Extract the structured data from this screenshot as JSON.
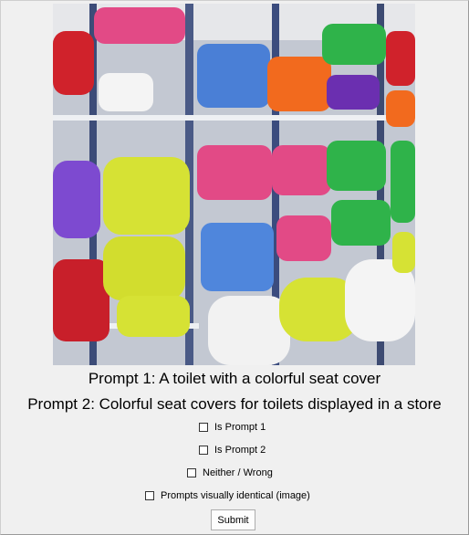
{
  "image": {
    "alt_icon": "photo-store-toilet-seat-covers"
  },
  "prompts": {
    "prompt1": "Prompt 1: A toilet with a colorful seat cover",
    "prompt2": "Prompt 2: Colorful seat covers for toilets displayed in a store"
  },
  "options": [
    {
      "label": "Is Prompt 1",
      "checked": false
    },
    {
      "label": "Is Prompt 2",
      "checked": false
    },
    {
      "label": "Neither / Wrong",
      "checked": false
    },
    {
      "label": "Prompts visually identical (image)",
      "checked": false
    }
  ],
  "submit_label": "Submit",
  "colors": {
    "red": "#d0222b",
    "magenta": "#e24a86",
    "blue": "#4a7fd6",
    "green": "#2fb34a",
    "yellow": "#d6e234",
    "purple": "#7d4ad0",
    "orange": "#f26a1e"
  }
}
